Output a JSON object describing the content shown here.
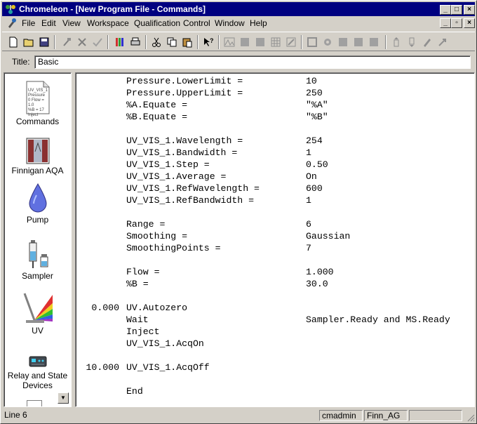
{
  "window": {
    "app_name": "Chromeleon",
    "title": "Chromeleon - [New Program File - Commands]"
  },
  "menu": [
    "File",
    "Edit",
    "View",
    "Workspace",
    "Qualification",
    "Control",
    "Window",
    "Help"
  ],
  "title_field": {
    "label": "Title:",
    "value": "Basic"
  },
  "sidebar": {
    "items": [
      {
        "label": "Commands",
        "icon": "commands-doc-icon",
        "thumb_lines": [
          "UV_VIS_1",
          "Pressure",
          "0 Flow = 1.0",
          "%B = 17",
          "Inject"
        ]
      },
      {
        "label": "Finnigan AQA",
        "icon": "mass-spec-icon"
      },
      {
        "label": "Pump",
        "icon": "pump-drop-icon"
      },
      {
        "label": "Sampler",
        "icon": "sampler-syringe-icon"
      },
      {
        "label": "UV",
        "icon": "uv-prism-icon"
      },
      {
        "label": "Relay and State Devices",
        "icon": "relay-device-icon"
      }
    ]
  },
  "program_lines": [
    {
      "time": "",
      "command": "Pressure.LowerLimit =",
      "value": "10"
    },
    {
      "time": "",
      "command": "Pressure.UpperLimit =",
      "value": "250"
    },
    {
      "time": "",
      "command": "%A.Equate =",
      "value": "\"%A\""
    },
    {
      "time": "",
      "command": "%B.Equate =",
      "value": "\"%B\""
    },
    {
      "time": "",
      "command": "",
      "value": ""
    },
    {
      "time": "",
      "command": "UV_VIS_1.Wavelength =",
      "value": "254"
    },
    {
      "time": "",
      "command": "UV_VIS_1.Bandwidth =",
      "value": "1"
    },
    {
      "time": "",
      "command": "UV_VIS_1.Step =",
      "value": "0.50"
    },
    {
      "time": "",
      "command": "UV_VIS_1.Average =",
      "value": "On"
    },
    {
      "time": "",
      "command": "UV_VIS_1.RefWavelength =",
      "value": "600"
    },
    {
      "time": "",
      "command": "UV_VIS_1.RefBandwidth =",
      "value": "1"
    },
    {
      "time": "",
      "command": "",
      "value": ""
    },
    {
      "time": "",
      "command": "Range =",
      "value": "6"
    },
    {
      "time": "",
      "command": "Smoothing =",
      "value": "Gaussian"
    },
    {
      "time": "",
      "command": "SmoothingPoints =",
      "value": "7"
    },
    {
      "time": "",
      "command": "",
      "value": ""
    },
    {
      "time": "",
      "command": "Flow =",
      "value": "1.000"
    },
    {
      "time": "",
      "command": "%B =",
      "value": "30.0"
    },
    {
      "time": "",
      "command": "",
      "value": ""
    },
    {
      "time": "0.000",
      "command": "UV.Autozero",
      "value": ""
    },
    {
      "time": "",
      "command": "Wait",
      "value": "Sampler.Ready and MS.Ready"
    },
    {
      "time": "",
      "command": "Inject",
      "value": ""
    },
    {
      "time": "",
      "command": "UV_VIS_1.AcqOn",
      "value": ""
    },
    {
      "time": "",
      "command": "",
      "value": ""
    },
    {
      "time": "10.000",
      "command": "UV_VIS_1.AcqOff",
      "value": ""
    },
    {
      "time": "",
      "command": "",
      "value": ""
    },
    {
      "time": "",
      "command": "End",
      "value": ""
    }
  ],
  "status": {
    "line": "Line 6",
    "user": "cmadmin",
    "server": "Finn_AG"
  },
  "colors": {
    "titlebar": "#000080",
    "face": "#d4d0c8"
  }
}
